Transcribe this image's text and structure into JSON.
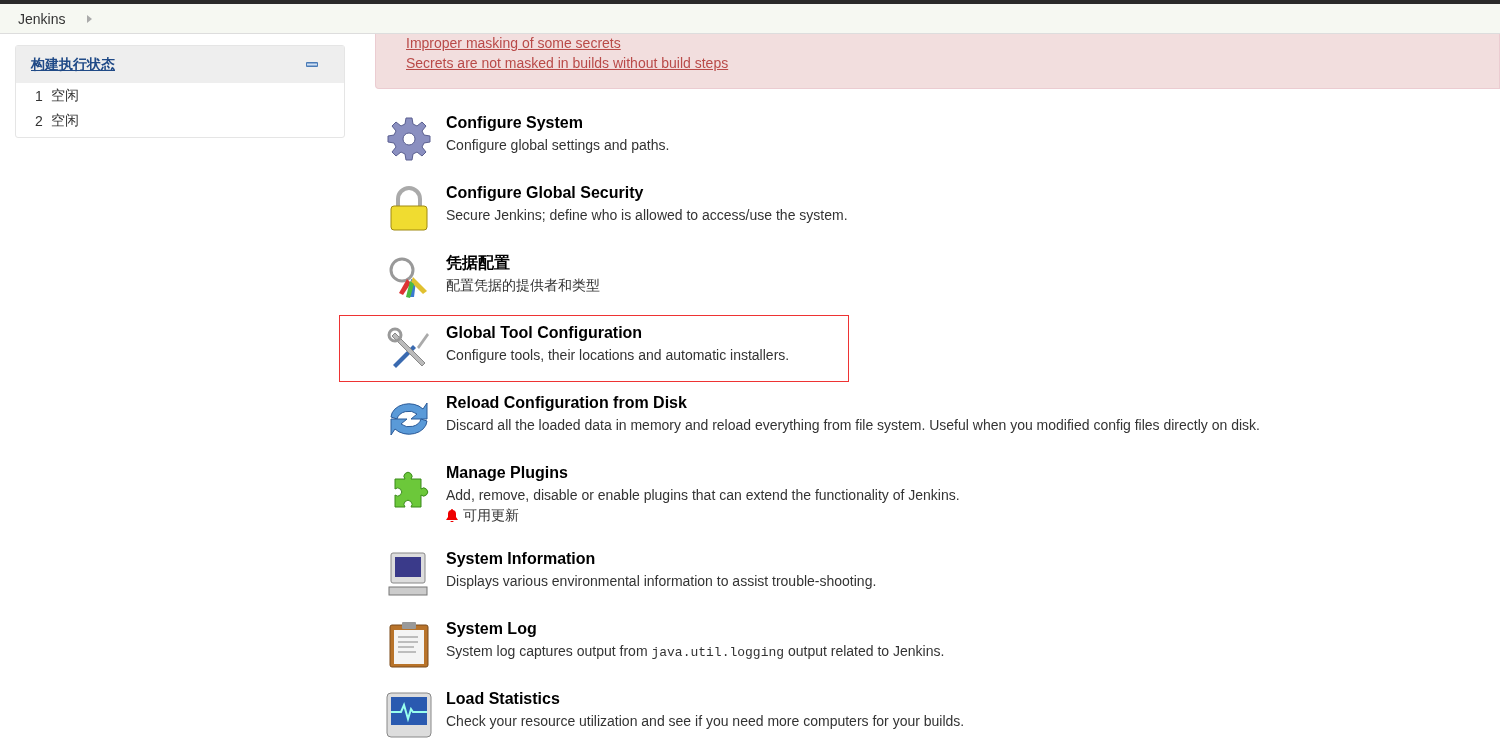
{
  "breadcrumb": {
    "items": [
      "Jenkins"
    ]
  },
  "executor_panel": {
    "title": "构建执行状态",
    "executors": [
      {
        "number": "1",
        "status": "空闲"
      },
      {
        "number": "2",
        "status": "空闲"
      }
    ]
  },
  "alert": {
    "links": [
      "Improper masking of some secrets",
      "Secrets are not masked in builds without build steps"
    ]
  },
  "manage_items": [
    {
      "kind": "gear",
      "title": "Configure System",
      "description": [
        {
          "kind": "text",
          "text": "Configure global settings and paths."
        }
      ],
      "highlighted": false
    },
    {
      "kind": "lock",
      "title": "Configure Global Security",
      "description": [
        {
          "kind": "text",
          "text": "Secure Jenkins; define who is allowed to access/use the system."
        }
      ],
      "highlighted": false
    },
    {
      "kind": "keys",
      "title": "凭据配置",
      "description": [
        {
          "kind": "text",
          "text": "配置凭据的提供者和类型"
        }
      ],
      "highlighted": false
    },
    {
      "kind": "tools",
      "title": "Global Tool Configuration",
      "description": [
        {
          "kind": "text",
          "text": "Configure tools, their locations and automatic installers."
        }
      ],
      "highlighted": true
    },
    {
      "kind": "reload",
      "title": "Reload Configuration from Disk",
      "description": [
        {
          "kind": "text",
          "text": "Discard all the loaded data in memory and reload everything from file system. Useful when you modified config files directly on disk."
        }
      ],
      "highlighted": false
    },
    {
      "kind": "puzzle",
      "title": "Manage Plugins",
      "description": [
        {
          "kind": "text",
          "text": "Add, remove, disable or enable plugins that can extend the functionality of Jenkins."
        }
      ],
      "notice": "可用更新",
      "highlighted": false
    },
    {
      "kind": "computer",
      "title": "System Information",
      "description": [
        {
          "kind": "text",
          "text": "Displays various environmental information to assist trouble-shooting."
        }
      ],
      "highlighted": false
    },
    {
      "kind": "clipboard",
      "title": "System Log",
      "description": [
        {
          "kind": "text",
          "text": "System log captures output from "
        },
        {
          "kind": "code",
          "text": "java.util.logging"
        },
        {
          "kind": "text",
          "text": " output related to Jenkins."
        }
      ],
      "highlighted": false
    },
    {
      "kind": "monitor",
      "title": "Load Statistics",
      "description": [
        {
          "kind": "text",
          "text": "Check your resource utilization and see if you need more computers for your builds."
        }
      ],
      "highlighted": false
    }
  ]
}
